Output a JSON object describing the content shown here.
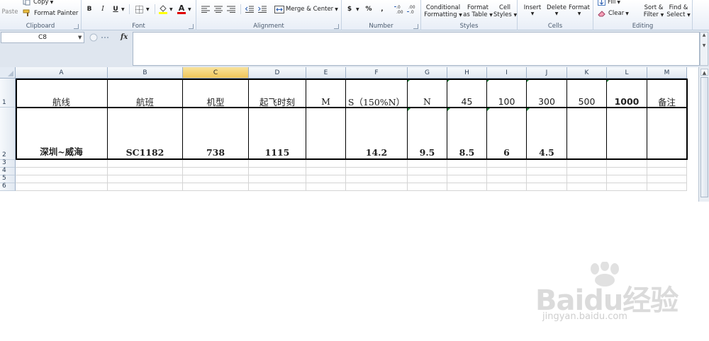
{
  "ribbon": {
    "clipboard": {
      "paste": "Paste",
      "copy": "Copy",
      "format_painter": "Format Painter",
      "label": "Clipboard"
    },
    "font": {
      "bold": "B",
      "italic": "I",
      "underline": "U",
      "font_color_glyph": "A",
      "label": "Font"
    },
    "alignment": {
      "merge_center": "Merge & Center",
      "label": "Alignment"
    },
    "number": {
      "currency": "$",
      "percent": "%",
      "comma": ",",
      "inc_decimal": "←.0 .00",
      "dec_decimal": ".00 →.0",
      "label": "Number"
    },
    "styles": {
      "conditional_1": "Conditional",
      "conditional_2": "Formatting",
      "format_1": "Format",
      "format_2": "as Table",
      "cell_1": "Cell",
      "cell_2": "Styles",
      "label": "Styles"
    },
    "cells": {
      "insert": "Insert",
      "delete": "Delete",
      "format": "Format",
      "label": "Cells"
    },
    "editing": {
      "fill": "Fill",
      "clear": "Clear",
      "sort_1": "Sort &",
      "sort_2": "Filter",
      "find_1": "Find &",
      "find_2": "Select",
      "label": "Editing"
    }
  },
  "formula_bar": {
    "name_box": "C8",
    "fx": "fx",
    "formula": ""
  },
  "sheet": {
    "columns": [
      "A",
      "B",
      "C",
      "D",
      "E",
      "F",
      "G",
      "H",
      "I",
      "J",
      "K",
      "L",
      "M"
    ],
    "selected_column": "C",
    "rows": [
      "1",
      "2",
      "3",
      "4",
      "5",
      "6"
    ],
    "row1": [
      "航线",
      "航班",
      "机型",
      "起飞时刻",
      "M",
      "S（150%N）",
      "N",
      "45",
      "100",
      "300",
      "500",
      "1000",
      "备注"
    ],
    "row2": [
      "深圳~威海",
      "SC1182",
      "738",
      "1115",
      "",
      "14.2",
      "9.5",
      "8.5",
      "6",
      "4.5",
      "",
      "",
      ""
    ],
    "error_indicator_cells": [
      "G1",
      "H1",
      "I1",
      "J1",
      "G2",
      "H2",
      "I2",
      "J2",
      "L1"
    ],
    "grid_color": "#d4d4d4",
    "selected_header_color": "#f1c659"
  },
  "watermark": {
    "logo": "Baidu经验",
    "url": "jingyan.baidu.com"
  }
}
